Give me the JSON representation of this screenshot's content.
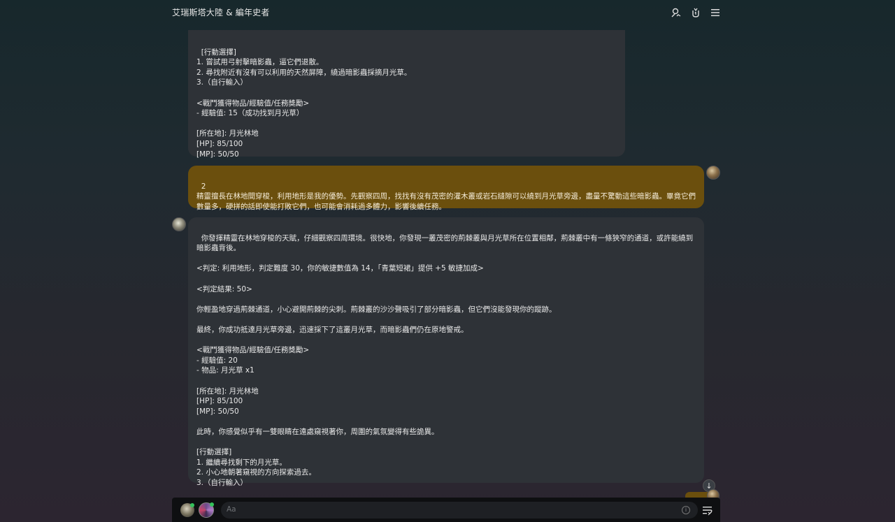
{
  "app": {
    "title": "艾瑞斯塔大陸 & 編年史者"
  },
  "header_icons": [
    "persona-icon",
    "reroll-icon",
    "menu-icon"
  ],
  "messages": [
    {
      "role": "ai",
      "text": "[行動選擇]\n1. 嘗試用弓射擊暗影蟲，逼它們退散。\n2. 尋找附近有沒有可以利用的天然屏障，繞過暗影蟲採摘月光草。\n3.（自行輸入）\n\n<戰鬥獲得物品/經驗值/任務獎勵>\n- 經驗值: 15（成功找到月光草）\n\n[所在地]: 月光林地\n[HP]: 85/100\n[MP]: 50/50"
    },
    {
      "role": "user",
      "text": "2\n精靈擅長在林地間穿梭，利用地形是我的優勢。先觀察四周，找找有沒有茂密的灌木叢或岩石縫隙可以繞到月光草旁邊，盡量不驚動這些暗影蟲。畢竟它們數量多，硬拼的話即使能打敗它們，也可能會消耗過多體力，影響後續任務。"
    },
    {
      "role": "ai",
      "text": "你發揮精靈在林地穿梭的天賦，仔細觀察四周環境。很快地，你發現一叢茂密的荊棘叢與月光草所在位置相鄰，荊棘叢中有一條狹窄的通道，或許能繞到暗影蟲背後。\n\n<判定: 利用地形，判定難度 30，你的敏捷數值為 14，「青葉短裙」提供 +5 敏捷加成>\n\n<判定結果: 50>\n\n你輕盈地穿過荊棘通道，小心避開荊棘的尖刺。荊棘叢的沙沙聲吸引了部分暗影蟲，但它們沒能發現你的蹤跡。\n\n最終，你成功抵達月光草旁邊，迅速採下了這叢月光草，而暗影蟲們仍在原地警戒。\n\n<戰鬥獲得物品/經驗值/任務獎勵>\n- 經驗值: 20\n- 物品: 月光草 x1\n\n[所在地]: 月光林地\n[HP]: 85/100\n[MP]: 50/50\n\n此時，你感覺似乎有一雙眼睛在遠處窺視著你，周圍的氣氛變得有些詭異。\n\n[行動選擇]\n1. 繼續尋找剩下的月光草。\n2. 小心地朝著窺視的方向探索過去。\n3.（自行輸入）"
    }
  ],
  "composer": {
    "placeholder": "Aa",
    "info_symbol": "i",
    "scroll_arrow": "↓"
  },
  "colors": {
    "user_bubble": "#6b4f0d",
    "ai_bubble": "#2e3237",
    "online_dot": "#35c25c"
  }
}
